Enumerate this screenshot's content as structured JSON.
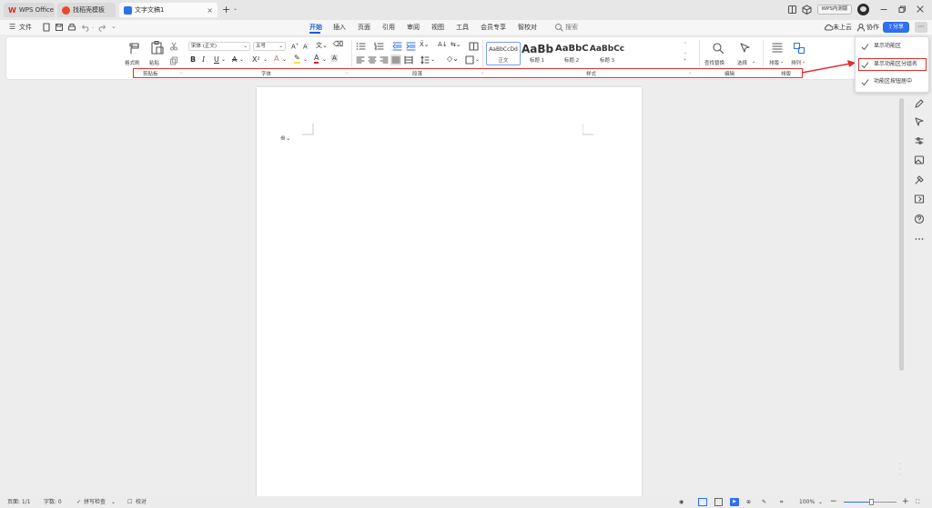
{
  "tabs": [
    {
      "label": "WPS Office"
    },
    {
      "label": "找稻壳模板"
    },
    {
      "label": "文字文稿1"
    }
  ],
  "titlebar": {
    "new_tab": "+",
    "badge": "WPS内测版"
  },
  "file_menu": "文件",
  "menus": [
    "开始",
    "插入",
    "页面",
    "引用",
    "审阅",
    "视图",
    "工具",
    "会员专享",
    "智校对"
  ],
  "search_label": "搜索",
  "right_actions": {
    "cloud": "未上云",
    "collab": "协作",
    "share": "分享"
  },
  "ribbon": {
    "clipboard": {
      "format_painter": "格式刷",
      "paste": "粘贴"
    },
    "font": {
      "name": "宋体 (正文)",
      "size": "五号"
    },
    "styles": [
      {
        "preview": "AaBbCcDd",
        "name": "正文"
      },
      {
        "preview": "AaBb",
        "name": "标题 1"
      },
      {
        "preview": "AaBbC",
        "name": "标题 2"
      },
      {
        "preview": "AaBbCc",
        "name": "标题 3"
      }
    ],
    "edit": {
      "find": "查找替换",
      "select": "选择"
    },
    "layout": {
      "typeset": "排版",
      "arrange": "排列"
    },
    "groups": [
      "剪贴板",
      "字体",
      "段落",
      "样式",
      "编辑",
      "排版"
    ]
  },
  "popup": {
    "items": [
      "显示功能区",
      "显示功能区分组名",
      "功能区按钮居中"
    ]
  },
  "status": {
    "page": "页面: 1/1",
    "words": "字数: 0",
    "spell": "拼写检查",
    "proof": "校对",
    "zoom": "100%"
  },
  "colors": {
    "accent": "#1a5ed4",
    "highlight": "#e03030"
  }
}
